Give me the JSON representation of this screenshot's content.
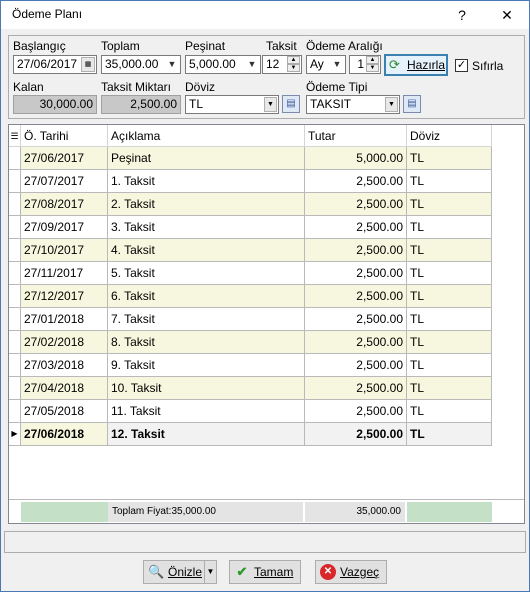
{
  "window": {
    "title": "Ödeme Planı",
    "help": "?",
    "close": "✕"
  },
  "form": {
    "baslangic_label": "Başlangıç",
    "baslangic_value": "27/06/2017",
    "toplam_label": "Toplam",
    "toplam_value": "35,000.00",
    "pesinat_label": "Peşinat",
    "pesinat_value": "5,000.00",
    "taksit_label": "Taksit",
    "taksit_value": "12",
    "odeme_araligi_label": "Ödeme Aralığı",
    "aralik_unit": "Ay",
    "aralik_value": "1",
    "hazirla_label": "Hazırla",
    "sifirla_label": "Sıfırla",
    "sifirla_checked": true,
    "kalan_label": "Kalan",
    "kalan_value": "30,000.00",
    "taksit_miktari_label": "Taksit Miktarı",
    "taksit_miktari_value": "2,500.00",
    "doviz_label": "Döviz",
    "doviz_value": "TL",
    "odeme_tipi_label": "Ödeme Tipi",
    "odeme_tipi_value": "TAKSIT"
  },
  "grid": {
    "columns": [
      "Ö. Tarihi",
      "Açıklama",
      "Tutar",
      "Döviz"
    ],
    "rows": [
      {
        "tarih": "27/06/2017",
        "aciklama": "Peşinat",
        "tutar": "5,000.00",
        "doviz": "TL"
      },
      {
        "tarih": "27/07/2017",
        "aciklama": "1. Taksit",
        "tutar": "2,500.00",
        "doviz": "TL"
      },
      {
        "tarih": "27/08/2017",
        "aciklama": "2. Taksit",
        "tutar": "2,500.00",
        "doviz": "TL"
      },
      {
        "tarih": "27/09/2017",
        "aciklama": "3. Taksit",
        "tutar": "2,500.00",
        "doviz": "TL"
      },
      {
        "tarih": "27/10/2017",
        "aciklama": "4. Taksit",
        "tutar": "2,500.00",
        "doviz": "TL"
      },
      {
        "tarih": "27/11/2017",
        "aciklama": "5. Taksit",
        "tutar": "2,500.00",
        "doviz": "TL"
      },
      {
        "tarih": "27/12/2017",
        "aciklama": "6. Taksit",
        "tutar": "2,500.00",
        "doviz": "TL"
      },
      {
        "tarih": "27/01/2018",
        "aciklama": "7. Taksit",
        "tutar": "2,500.00",
        "doviz": "TL"
      },
      {
        "tarih": "27/02/2018",
        "aciklama": "8. Taksit",
        "tutar": "2,500.00",
        "doviz": "TL"
      },
      {
        "tarih": "27/03/2018",
        "aciklama": "9. Taksit",
        "tutar": "2,500.00",
        "doviz": "TL"
      },
      {
        "tarih": "27/04/2018",
        "aciklama": "10. Taksit",
        "tutar": "2,500.00",
        "doviz": "TL"
      },
      {
        "tarih": "27/05/2018",
        "aciklama": "11. Taksit",
        "tutar": "2,500.00",
        "doviz": "TL"
      },
      {
        "tarih": "27/06/2018",
        "aciklama": "12. Taksit",
        "tutar": "2,500.00",
        "doviz": "TL"
      }
    ],
    "selected_row": 12,
    "footer_label": "Toplam Fiyat:35,000.00",
    "footer_total": "35,000.00"
  },
  "buttons": {
    "onizle": "Önizle",
    "tamam": "Tamam",
    "vazgec": "Vazgeç"
  },
  "colors": {
    "row_alt": "#f7f7df",
    "footer_green": "#c4e0c6",
    "accent": "#3c7fb1"
  }
}
